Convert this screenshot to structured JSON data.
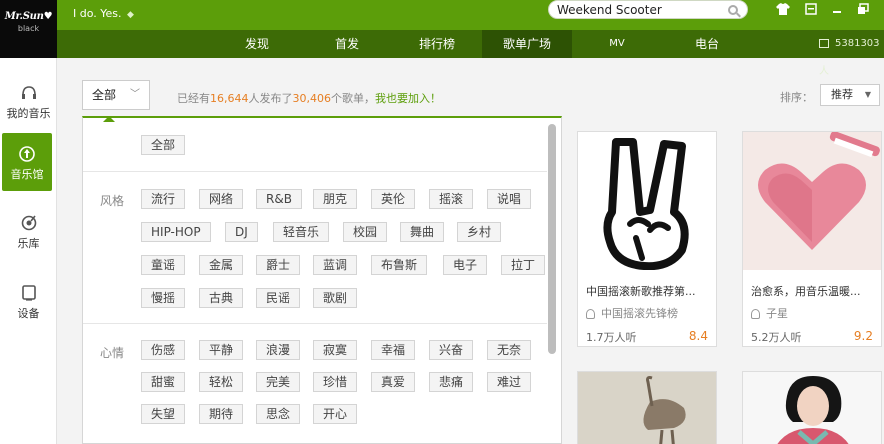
{
  "app": {
    "logo_line1": "Mr.Sun♥",
    "logo_line2": "black",
    "user_text": "I do. Yes.",
    "vip_glyph": "💎"
  },
  "search": {
    "value": "Weekend Scooter",
    "icon": "search-icon"
  },
  "window_controls": [
    "skin-icon",
    "mini-mode-icon",
    "minimize-icon",
    "maximize-icon"
  ],
  "nav": {
    "items": [
      "发现",
      "首发",
      "排行榜",
      "歌单广场",
      "MV",
      "电台"
    ],
    "active": "歌单广场",
    "online_count": "5381303人"
  },
  "sidebar": {
    "items": [
      {
        "label": "我的音乐",
        "icon": "headphones-icon"
      },
      {
        "label": "音乐馆",
        "icon": "music-hall-icon"
      },
      {
        "label": "乐库",
        "icon": "library-icon"
      },
      {
        "label": "设备",
        "icon": "device-icon"
      }
    ],
    "active": "音乐馆"
  },
  "filter": {
    "button_label": "全部",
    "stats_prefix": "已经有",
    "users": "16,644",
    "stats_mid": "人发布了",
    "playlists": "30,406",
    "stats_suffix": "个歌单，",
    "join_link": "我也要加入",
    "join_end": "！",
    "sort_label": "排序：",
    "sort_value": "推荐"
  },
  "panel": {
    "all_tag": "全部",
    "sections": [
      {
        "label": "风格",
        "rows": [
          [
            "流行",
            "网络",
            "R&B",
            "朋克",
            "英伦",
            "摇滚",
            "说唱"
          ],
          [
            "HIP-HOP",
            "DJ",
            "轻音乐",
            "校园",
            "舞曲",
            "乡村"
          ],
          [
            "童谣",
            "金属",
            "爵士",
            "蓝调",
            "布鲁斯",
            "电子",
            "拉丁"
          ],
          [
            "慢摇",
            "古典",
            "民谣",
            "歌剧"
          ]
        ]
      },
      {
        "label": "心情",
        "rows": [
          [
            "伤感",
            "平静",
            "浪漫",
            "寂寞",
            "幸福",
            "兴奋",
            "无奈"
          ],
          [
            "甜蜜",
            "轻松",
            "完美",
            "珍惜",
            "真爱",
            "悲痛",
            "难过"
          ],
          [
            "失望",
            "期待",
            "思念",
            "开心"
          ]
        ]
      }
    ]
  },
  "cards": [
    {
      "title": "中国摇滚新歌推荐第...",
      "author": "中国摇滚先锋榜",
      "plays": "1.7万人听",
      "score": "8.4"
    },
    {
      "title": "治愈系，用音乐温暖...",
      "author": "子星",
      "plays": "5.2万人听",
      "score": "9.2"
    }
  ]
}
